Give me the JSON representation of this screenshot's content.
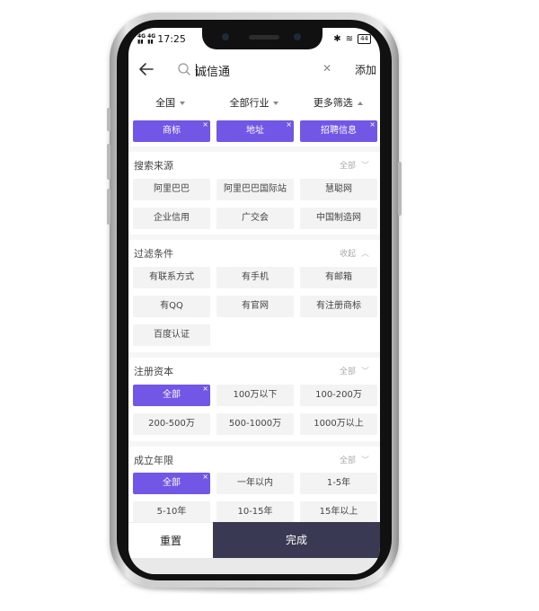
{
  "status_bar": {
    "network_1": "4G",
    "network_2": "4G",
    "time": "17:25",
    "bluetooth": "✱",
    "wifi": "≋",
    "battery": "44"
  },
  "search": {
    "query": "诚信通",
    "clear_icon": "close-icon",
    "add_label": "添加"
  },
  "filter_tabs": [
    {
      "label": "全国",
      "caret": "down"
    },
    {
      "label": "全部行业",
      "caret": "down"
    },
    {
      "label": "更多筛选",
      "caret": "up"
    }
  ],
  "selected_tags": [
    {
      "label": "商标"
    },
    {
      "label": "地址"
    },
    {
      "label": "招聘信息"
    }
  ],
  "source_section": {
    "title": "搜索来源",
    "toggle_label": "全部",
    "options": [
      "阿里巴巴",
      "阿里巴巴国际站",
      "慧聪网",
      "企业信用",
      "广交会",
      "中国制造网"
    ]
  },
  "condition_section": {
    "title": "过滤条件",
    "toggle_label": "收起",
    "options": [
      "有联系方式",
      "有手机",
      "有邮箱",
      "有QQ",
      "有官网",
      "有注册商标",
      "百度认证"
    ]
  },
  "capital_section": {
    "title": "注册资本",
    "toggle_label": "全部",
    "options": [
      "全部",
      "100万以下",
      "100-200万",
      "200-500万",
      "500-1000万",
      "1000万以上"
    ],
    "selected": "全部"
  },
  "years_section": {
    "title": "成立年限",
    "toggle_label": "全部",
    "options": [
      "全部",
      "一年以内",
      "1-5年",
      "5-10年",
      "10-15年",
      "15年以上"
    ],
    "selected": "全部"
  },
  "bottom": {
    "reset_label": "重置",
    "done_label": "完成"
  },
  "colors": {
    "accent": "#7256e6",
    "done_bg": "#3a3954"
  }
}
